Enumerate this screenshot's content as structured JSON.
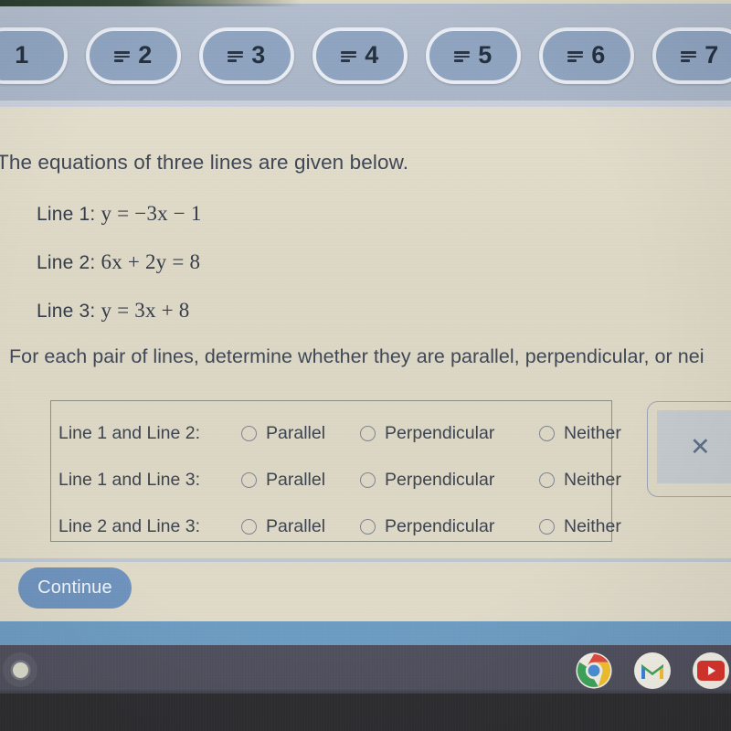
{
  "tabbar": {
    "tabs": [
      {
        "label": "1",
        "icon": ""
      },
      {
        "label": "2",
        "icon": "list-icon"
      },
      {
        "label": "3",
        "icon": "list-icon"
      },
      {
        "label": "4",
        "icon": "list-icon"
      },
      {
        "label": "5",
        "icon": "list-icon"
      },
      {
        "label": "6",
        "icon": "list-icon"
      },
      {
        "label": "7",
        "icon": "list-icon"
      }
    ]
  },
  "question": {
    "prompt": "The equations of three lines are given below.",
    "equations": [
      {
        "label": "Line 1:",
        "body": "y = −3x − 1"
      },
      {
        "label": "Line 2:",
        "body": "6x + 2y = 8"
      },
      {
        "label": "Line 3:",
        "body": "y = 3x + 8"
      }
    ],
    "instruction": "For each pair of lines, determine whether they are parallel, perpendicular, or nei"
  },
  "answer_table": {
    "option_labels": {
      "parallel": "Parallel",
      "perpendicular": "Perpendicular",
      "neither": "Neither"
    },
    "rows": [
      {
        "label": "Line 1 and Line 2:",
        "selected": ""
      },
      {
        "label": "Line 1 and Line 3:",
        "selected": ""
      },
      {
        "label": "Line 2 and Line 3:",
        "selected": ""
      }
    ]
  },
  "side_panel": {
    "icon": "close-x-icon",
    "glyph": "✕"
  },
  "footer": {
    "continue_label": "Continue"
  },
  "shelf": {
    "launcher_icon": "launcher-icon",
    "apps": [
      {
        "name": "chrome-icon"
      },
      {
        "name": "gmail-icon"
      },
      {
        "name": "youtube-icon"
      }
    ]
  },
  "colors": {
    "tabbar_bg": "#adb8c9",
    "tab_fill": "#8fa4c0",
    "content_bg": "#ddd7c5",
    "continue_bg": "#6e93bd",
    "blue_band": "#6d9cc2",
    "shelf_bg": "#50505e",
    "text": "#3d4450"
  }
}
